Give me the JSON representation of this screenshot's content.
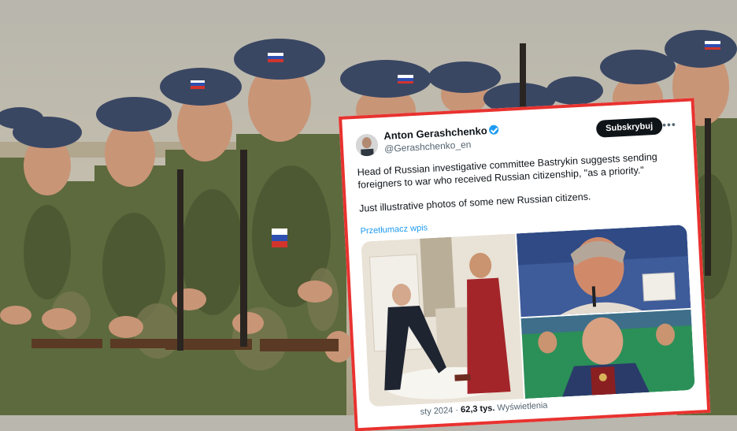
{
  "tweet": {
    "author_name": "Anton Gerashchenko",
    "handle": "@Gerashchenko_en",
    "subscribe_label": "Subskrybuj",
    "more_icon": "more-dots-icon",
    "text_line1": "Head of Russian investigative committee Bastrykin suggests sending foreigners to war who received Russian citizenship, \"as a priority.\"",
    "text_line2": "Just illustrative photos of some new Russian citizens.",
    "translate_label": "Przetłumacz wpis",
    "date_fragment": "sty 2024",
    "views_count": "62,3 tys.",
    "views_label": "Wyświetlenia"
  },
  "colors": {
    "frame_red": "#e8322f",
    "verified_blue": "#1d9bf0",
    "camo_green": "#5d6a3e",
    "beret_blue": "#3a4763"
  }
}
